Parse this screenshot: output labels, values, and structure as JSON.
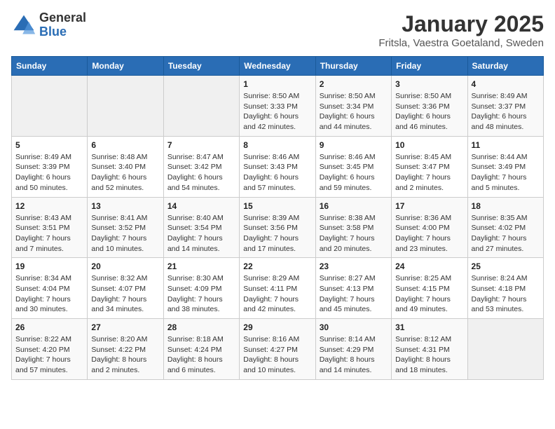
{
  "logo": {
    "general": "General",
    "blue": "Blue"
  },
  "title": "January 2025",
  "subtitle": "Fritsla, Vaestra Goetaland, Sweden",
  "days_of_week": [
    "Sunday",
    "Monday",
    "Tuesday",
    "Wednesday",
    "Thursday",
    "Friday",
    "Saturday"
  ],
  "weeks": [
    [
      {
        "day": "",
        "info": ""
      },
      {
        "day": "",
        "info": ""
      },
      {
        "day": "",
        "info": ""
      },
      {
        "day": "1",
        "info": "Sunrise: 8:50 AM\nSunset: 3:33 PM\nDaylight: 6 hours and 42 minutes."
      },
      {
        "day": "2",
        "info": "Sunrise: 8:50 AM\nSunset: 3:34 PM\nDaylight: 6 hours and 44 minutes."
      },
      {
        "day": "3",
        "info": "Sunrise: 8:50 AM\nSunset: 3:36 PM\nDaylight: 6 hours and 46 minutes."
      },
      {
        "day": "4",
        "info": "Sunrise: 8:49 AM\nSunset: 3:37 PM\nDaylight: 6 hours and 48 minutes."
      }
    ],
    [
      {
        "day": "5",
        "info": "Sunrise: 8:49 AM\nSunset: 3:39 PM\nDaylight: 6 hours and 50 minutes."
      },
      {
        "day": "6",
        "info": "Sunrise: 8:48 AM\nSunset: 3:40 PM\nDaylight: 6 hours and 52 minutes."
      },
      {
        "day": "7",
        "info": "Sunrise: 8:47 AM\nSunset: 3:42 PM\nDaylight: 6 hours and 54 minutes."
      },
      {
        "day": "8",
        "info": "Sunrise: 8:46 AM\nSunset: 3:43 PM\nDaylight: 6 hours and 57 minutes."
      },
      {
        "day": "9",
        "info": "Sunrise: 8:46 AM\nSunset: 3:45 PM\nDaylight: 6 hours and 59 minutes."
      },
      {
        "day": "10",
        "info": "Sunrise: 8:45 AM\nSunset: 3:47 PM\nDaylight: 7 hours and 2 minutes."
      },
      {
        "day": "11",
        "info": "Sunrise: 8:44 AM\nSunset: 3:49 PM\nDaylight: 7 hours and 5 minutes."
      }
    ],
    [
      {
        "day": "12",
        "info": "Sunrise: 8:43 AM\nSunset: 3:51 PM\nDaylight: 7 hours and 7 minutes."
      },
      {
        "day": "13",
        "info": "Sunrise: 8:41 AM\nSunset: 3:52 PM\nDaylight: 7 hours and 10 minutes."
      },
      {
        "day": "14",
        "info": "Sunrise: 8:40 AM\nSunset: 3:54 PM\nDaylight: 7 hours and 14 minutes."
      },
      {
        "day": "15",
        "info": "Sunrise: 8:39 AM\nSunset: 3:56 PM\nDaylight: 7 hours and 17 minutes."
      },
      {
        "day": "16",
        "info": "Sunrise: 8:38 AM\nSunset: 3:58 PM\nDaylight: 7 hours and 20 minutes."
      },
      {
        "day": "17",
        "info": "Sunrise: 8:36 AM\nSunset: 4:00 PM\nDaylight: 7 hours and 23 minutes."
      },
      {
        "day": "18",
        "info": "Sunrise: 8:35 AM\nSunset: 4:02 PM\nDaylight: 7 hours and 27 minutes."
      }
    ],
    [
      {
        "day": "19",
        "info": "Sunrise: 8:34 AM\nSunset: 4:04 PM\nDaylight: 7 hours and 30 minutes."
      },
      {
        "day": "20",
        "info": "Sunrise: 8:32 AM\nSunset: 4:07 PM\nDaylight: 7 hours and 34 minutes."
      },
      {
        "day": "21",
        "info": "Sunrise: 8:30 AM\nSunset: 4:09 PM\nDaylight: 7 hours and 38 minutes."
      },
      {
        "day": "22",
        "info": "Sunrise: 8:29 AM\nSunset: 4:11 PM\nDaylight: 7 hours and 42 minutes."
      },
      {
        "day": "23",
        "info": "Sunrise: 8:27 AM\nSunset: 4:13 PM\nDaylight: 7 hours and 45 minutes."
      },
      {
        "day": "24",
        "info": "Sunrise: 8:25 AM\nSunset: 4:15 PM\nDaylight: 7 hours and 49 minutes."
      },
      {
        "day": "25",
        "info": "Sunrise: 8:24 AM\nSunset: 4:18 PM\nDaylight: 7 hours and 53 minutes."
      }
    ],
    [
      {
        "day": "26",
        "info": "Sunrise: 8:22 AM\nSunset: 4:20 PM\nDaylight: 7 hours and 57 minutes."
      },
      {
        "day": "27",
        "info": "Sunrise: 8:20 AM\nSunset: 4:22 PM\nDaylight: 8 hours and 2 minutes."
      },
      {
        "day": "28",
        "info": "Sunrise: 8:18 AM\nSunset: 4:24 PM\nDaylight: 8 hours and 6 minutes."
      },
      {
        "day": "29",
        "info": "Sunrise: 8:16 AM\nSunset: 4:27 PM\nDaylight: 8 hours and 10 minutes."
      },
      {
        "day": "30",
        "info": "Sunrise: 8:14 AM\nSunset: 4:29 PM\nDaylight: 8 hours and 14 minutes."
      },
      {
        "day": "31",
        "info": "Sunrise: 8:12 AM\nSunset: 4:31 PM\nDaylight: 8 hours and 18 minutes."
      },
      {
        "day": "",
        "info": ""
      }
    ]
  ]
}
